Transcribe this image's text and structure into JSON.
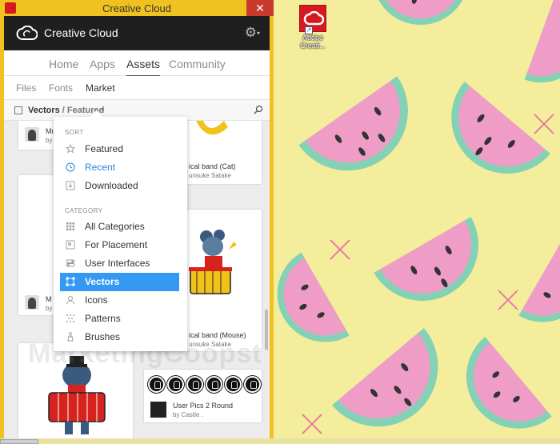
{
  "window": {
    "title": "Creative Cloud"
  },
  "app": {
    "name": "Creative Cloud"
  },
  "nav_tabs": [
    "Home",
    "Apps",
    "Assets",
    "Community"
  ],
  "sub_tabs": [
    "Files",
    "Fonts",
    "Market"
  ],
  "filter": {
    "category": "Vectors",
    "separator": " / ",
    "sort": "Featured"
  },
  "cards": [
    {
      "title": "Mu",
      "author": "by"
    },
    {
      "title": "ical band (Cat)",
      "author": "unsuke Satake"
    },
    {
      "title": "M",
      "author": "by"
    },
    {
      "title": "ical band (Mouse)",
      "author": "unsuke Satake"
    },
    {
      "title": "User Pics 2 Round",
      "author": "by Castle ."
    }
  ],
  "dropdown": {
    "sort_heading": "SORT",
    "sort_items": [
      "Featured",
      "Recent",
      "Downloaded"
    ],
    "category_heading": "CATEGORY",
    "category_items": [
      "All Categories",
      "For Placement",
      "User Interfaces",
      "Vectors",
      "Icons",
      "Patterns",
      "Brushes"
    ],
    "selected_category": "Vectors",
    "active_sort": "Recent"
  },
  "desktop": {
    "icon_label": "Adobe Creati..."
  },
  "watermark": "MarketingCoopst",
  "colors": {
    "window_border": "#f0c21f",
    "appbar": "#1f1f1f",
    "selected": "#3399f3",
    "link_blue": "#2a82d6",
    "desktop_bg": "#f4ee9c",
    "melon_pink": "#ef9dc7",
    "melon_rind": "#84d1b5"
  }
}
